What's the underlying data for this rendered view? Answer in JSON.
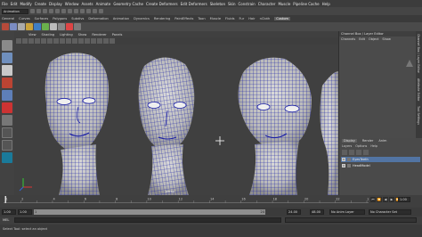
{
  "menubar": [
    "File",
    "Edit",
    "Modify",
    "Create",
    "Display",
    "Window",
    "Assets",
    "Animate",
    "Geometry Cache",
    "Create Deformers",
    "Edit Deformers",
    "Skeleton",
    "Skin",
    "Constrain",
    "Character",
    "Muscle",
    "Pipeline Cache",
    "Help"
  ],
  "statusline": {
    "mode": "Animation"
  },
  "shelf_tabs": [
    "General",
    "Curves",
    "Surfaces",
    "Polygons",
    "Subdivs",
    "Deformation",
    "Animation",
    "Dynamics",
    "Rendering",
    "PaintEffects",
    "Toon",
    "Muscle",
    "Fluids",
    "Fur",
    "Hair",
    "nCloth",
    "Custom"
  ],
  "shelf_active": "Custom",
  "panel_menu": [
    "View",
    "Shading",
    "Lighting",
    "Show",
    "Renderer",
    "Panels"
  ],
  "viewport": {
    "camera_label": "persp"
  },
  "channel_box": {
    "title": "Channel Box / Layer Editor",
    "menu": [
      "Channels",
      "Edit",
      "Object",
      "Show"
    ]
  },
  "side_tabs": [
    "Channel Box / Layer Editor",
    "Attribute Editor",
    "Tool Settings"
  ],
  "layer_editor": {
    "tabs": [
      "Display",
      "Render",
      "Anim"
    ],
    "active_tab": "Display",
    "menu": [
      "Layers",
      "Options",
      "Help"
    ],
    "layers": [
      {
        "vis": "V",
        "name": "EyesTeeth",
        "selected": true
      },
      {
        "vis": "V",
        "name": "HeadModel",
        "selected": false
      }
    ]
  },
  "timeslider": {
    "tick_labels": [
      "1",
      "2",
      "4",
      "6",
      "8",
      "10",
      "12",
      "14",
      "16",
      "18",
      "20",
      "22",
      "24"
    ],
    "current_frame": "1.00"
  },
  "rangeslider": {
    "start": "1.00",
    "inner_start": "1.00",
    "inner_start2": "1",
    "range_end_label": "24",
    "end": "24.00",
    "anim_end": "48.00",
    "anim_layer": "No Anim Layer",
    "char_set": "No Character Set"
  },
  "cmdline": {
    "label": "MEL"
  },
  "helpline": {
    "text": "Select Tool: select an object"
  },
  "colors": {
    "wire": "#1a1fa6",
    "mesh": "#c8c8c8",
    "selected_layer": "#5274a3"
  }
}
